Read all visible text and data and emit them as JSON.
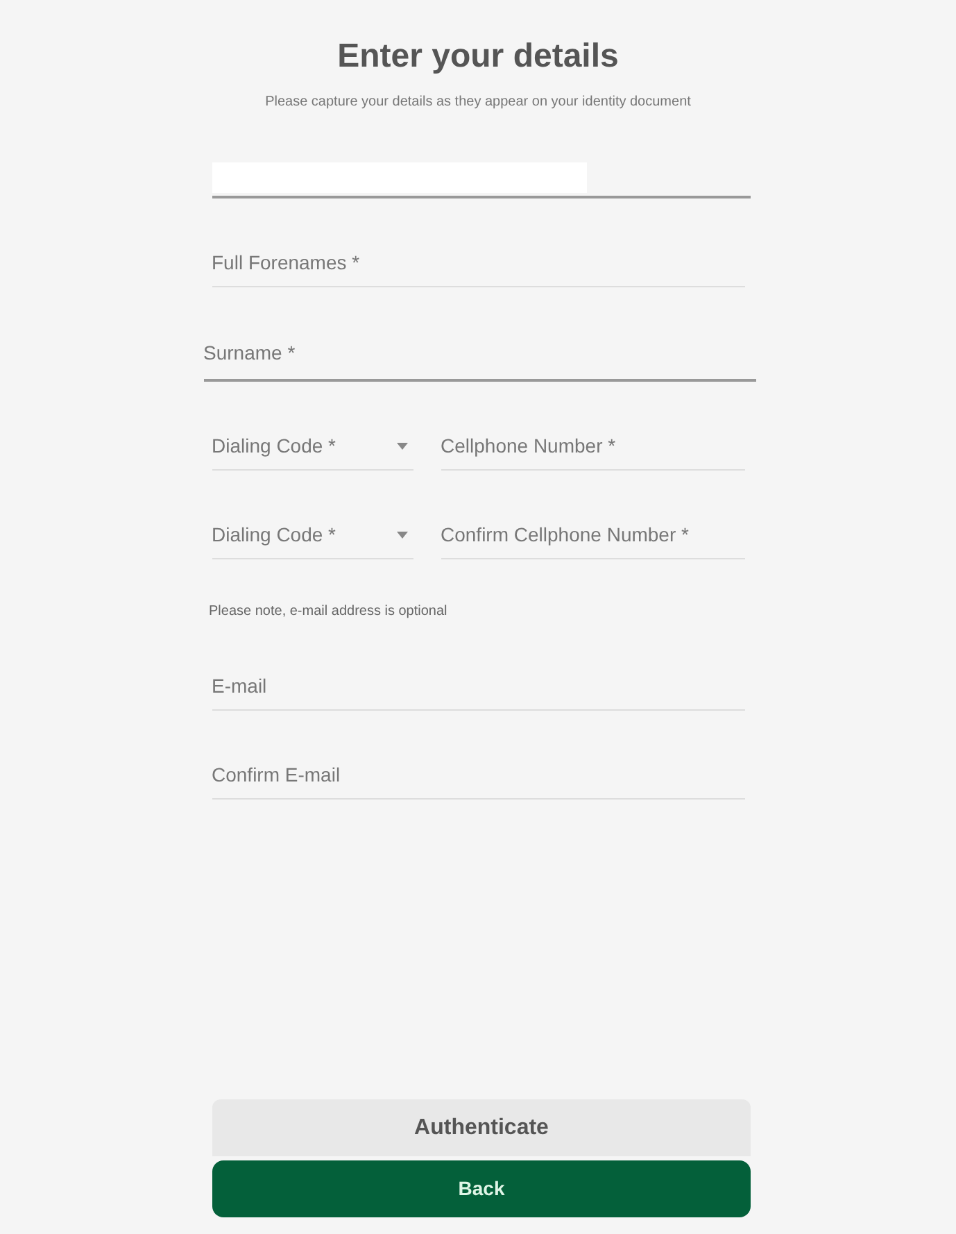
{
  "title": "Enter your details",
  "subtitle": "Please capture your details as they appear on your identity document",
  "fields": [
    {
      "kind": "blank",
      "focused": true
    },
    {
      "kind": "text",
      "label": "Full Forenames *",
      "focused": false
    },
    {
      "kind": "text",
      "label": "Surname *",
      "focused": true
    },
    {
      "kind": "phone",
      "code_label": "Dialing Code *",
      "label": "Cellphone Number *",
      "focused": false
    },
    {
      "kind": "phone",
      "code_label": "Dialing Code *",
      "label": "Confirm Cellphone Number *",
      "focused": false
    },
    {
      "kind": "note",
      "text": "Please note, e-mail address is optional"
    },
    {
      "kind": "text",
      "label": "E-mail",
      "focused": false
    },
    {
      "kind": "text",
      "label": "Confirm E-mail",
      "focused": false
    }
  ],
  "buttons": [
    {
      "label": "Authenticate",
      "kind": "secondary"
    },
    {
      "label": "Back",
      "kind": "primary"
    }
  ]
}
